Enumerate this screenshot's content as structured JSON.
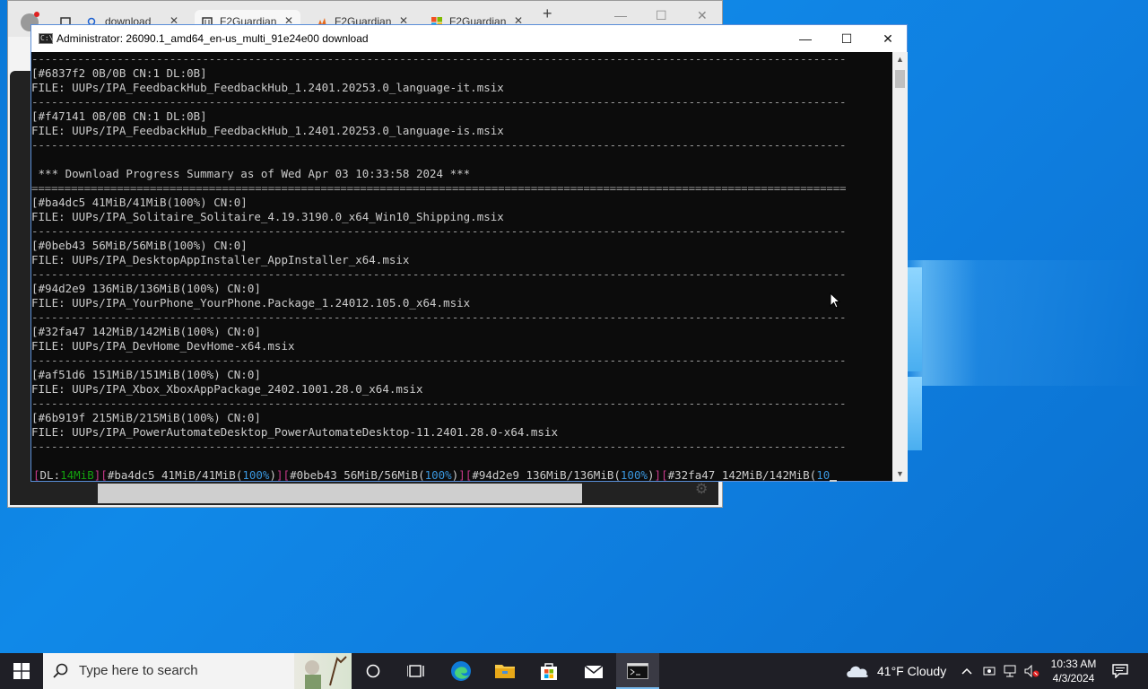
{
  "browser": {
    "tabs": [
      {
        "label": "download"
      },
      {
        "label": "F2Guardian"
      },
      {
        "label": "F2Guardian"
      },
      {
        "label": "F2Guardian"
      }
    ],
    "new_tab": "+",
    "min": "—",
    "max": "☐",
    "close": "✕"
  },
  "console": {
    "title": "Administrator:  26090.1_amd64_en-us_multi_91e24e00 download",
    "icon_text": "C:\\",
    "controls": {
      "minimize": "—",
      "maximize": "☐",
      "close": "✕"
    },
    "lines": [
      {
        "kind": "dash"
      },
      {
        "kind": "text",
        "text": "[#6837f2 0B/0B CN:1 DL:0B]"
      },
      {
        "kind": "text",
        "text": "FILE: UUPs/IPA_FeedbackHub_FeedbackHub_1.2401.20253.0_language-it.msix"
      },
      {
        "kind": "dash"
      },
      {
        "kind": "text",
        "text": "[#f47141 0B/0B CN:1 DL:0B]"
      },
      {
        "kind": "text",
        "text": "FILE: UUPs/IPA_FeedbackHub_FeedbackHub_1.2401.20253.0_language-is.msix"
      },
      {
        "kind": "dash"
      },
      {
        "kind": "blank"
      },
      {
        "kind": "text",
        "text": " *** Download Progress Summary as of Wed Apr 03 10:33:58 2024 ***"
      },
      {
        "kind": "equals"
      },
      {
        "kind": "text",
        "text": "[#ba4dc5 41MiB/41MiB(100%) CN:0]"
      },
      {
        "kind": "text",
        "text": "FILE: UUPs/IPA_Solitaire_Solitaire_4.19.3190.0_x64_Win10_Shipping.msix"
      },
      {
        "kind": "dash"
      },
      {
        "kind": "text",
        "text": "[#0beb43 56MiB/56MiB(100%) CN:0]"
      },
      {
        "kind": "text",
        "text": "FILE: UUPs/IPA_DesktopAppInstaller_AppInstaller_x64.msix"
      },
      {
        "kind": "dash"
      },
      {
        "kind": "text",
        "text": "[#94d2e9 136MiB/136MiB(100%) CN:0]"
      },
      {
        "kind": "text",
        "text": "FILE: UUPs/IPA_YourPhone_YourPhone.Package_1.24012.105.0_x64.msix"
      },
      {
        "kind": "dash"
      },
      {
        "kind": "text",
        "text": "[#32fa47 142MiB/142MiB(100%) CN:0]"
      },
      {
        "kind": "text",
        "text": "FILE: UUPs/IPA_DevHome_DevHome-x64.msix"
      },
      {
        "kind": "dash"
      },
      {
        "kind": "text",
        "text": "[#af51d6 151MiB/151MiB(100%) CN:0]"
      },
      {
        "kind": "text",
        "text": "FILE: UUPs/IPA_Xbox_XboxAppPackage_2402.1001.28.0_x64.msix"
      },
      {
        "kind": "dash"
      },
      {
        "kind": "text",
        "text": "[#6b919f 215MiB/215MiB(100%) CN:0]"
      },
      {
        "kind": "text",
        "text": "FILE: UUPs/IPA_PowerAutomateDesktop_PowerAutomateDesktop-11.2401.28.0-x64.msix"
      },
      {
        "kind": "dash"
      }
    ],
    "status": {
      "dl_label": "DL:",
      "dl_value": "14MiB",
      "items": [
        {
          "id": "#ba4dc5",
          "size": "41MiB/41MiB",
          "pct": "100%"
        },
        {
          "id": "#0beb43",
          "size": "56MiB/56MiB",
          "pct": "100%"
        },
        {
          "id": "#94d2e9",
          "size": "136MiB/136MiB",
          "pct": "100%"
        },
        {
          "id": "#32fa47",
          "size": "142MiB/142MiB",
          "pct": "10"
        }
      ]
    }
  },
  "taskbar": {
    "search_placeholder": "Type here to search",
    "weather": "41°F  Cloudy",
    "time": "10:33 AM",
    "date": "4/3/2024",
    "accent": "#76b9ed"
  }
}
